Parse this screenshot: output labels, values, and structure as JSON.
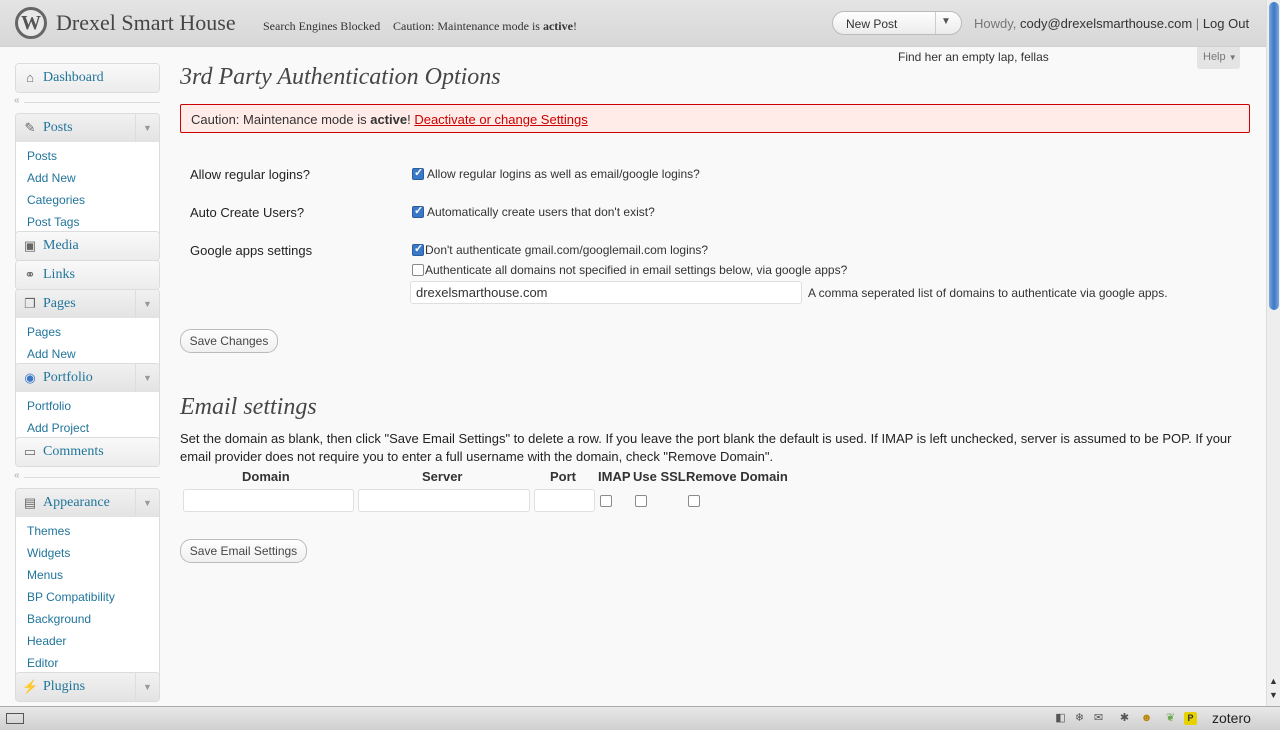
{
  "header": {
    "site_title": "Drexel Smart House",
    "search_engines_notice": "Search Engines Blocked",
    "maintenance_notice_prefix": "Caution: Maintenance mode is ",
    "maintenance_notice_bold": "active",
    "maintenance_notice_suffix": "!",
    "new_post_label": "New Post",
    "howdy": "Howdy,",
    "user_email": "cody@drexelsmarthouse.com",
    "separator": "|",
    "logout": "Log Out"
  },
  "sidebar": {
    "dashboard": "Dashboard",
    "posts": {
      "label": "Posts",
      "items": [
        "Posts",
        "Add New",
        "Categories",
        "Post Tags"
      ]
    },
    "media": "Media",
    "links": "Links",
    "pages": {
      "label": "Pages",
      "items": [
        "Pages",
        "Add New"
      ]
    },
    "portfolio": {
      "label": "Portfolio",
      "items": [
        "Portfolio",
        "Add Project"
      ]
    },
    "comments": "Comments",
    "appearance": {
      "label": "Appearance",
      "items": [
        "Themes",
        "Widgets",
        "Menus",
        "BP Compatibility",
        "Background",
        "Header",
        "Editor"
      ]
    },
    "plugins": "Plugins"
  },
  "main": {
    "tagline": "Find her an empty lap, fellas",
    "help": "Help",
    "title": "3rd Party Authentication Options",
    "notice": {
      "prefix": "Caution: Maintenance mode is ",
      "bold": "active",
      "suffix": "! ",
      "link": "Deactivate or change Settings"
    },
    "settings": {
      "regular_logins": {
        "label": "Allow regular logins?",
        "option": "Allow regular logins as well as email/google logins?",
        "checked": true
      },
      "auto_create": {
        "label": "Auto Create Users?",
        "option": "Automatically create users that don't exist?",
        "checked": true
      },
      "google_apps": {
        "label": "Google apps settings",
        "option1": "Don't authenticate gmail.com/googlemail.com logins?",
        "option1_checked": true,
        "option2": "Authenticate all domains not specified in email settings below, via google apps?",
        "option2_checked": false,
        "domains_value": "drexelsmarthouse.com",
        "domains_hint": "A comma seperated list of domains to authenticate via google apps."
      }
    },
    "save_changes": "Save Changes",
    "email": {
      "title": "Email settings",
      "description": "Set the domain as blank, then click \"Save Email Settings\" to delete a row. If you leave the port blank the default is used. If IMAP is left unchecked, server is assumed to be POP. If your email provider does not require you to enter a full username with the domain, check \"Remove Domain\".",
      "columns": [
        "Domain",
        "Server",
        "Port",
        "IMAP",
        "Use SSL",
        "Remove Domain"
      ],
      "row": {
        "domain": "",
        "server": "",
        "port": "",
        "imap": false,
        "ssl": false,
        "remove_domain": false
      },
      "save": "Save Email Settings"
    }
  },
  "statusbar": {
    "zotero": "zotero"
  },
  "colors": {
    "link": "#21759b",
    "notice_bg": "#ffebe8",
    "notice_border": "#cc0000",
    "check": "#3a78c8"
  }
}
